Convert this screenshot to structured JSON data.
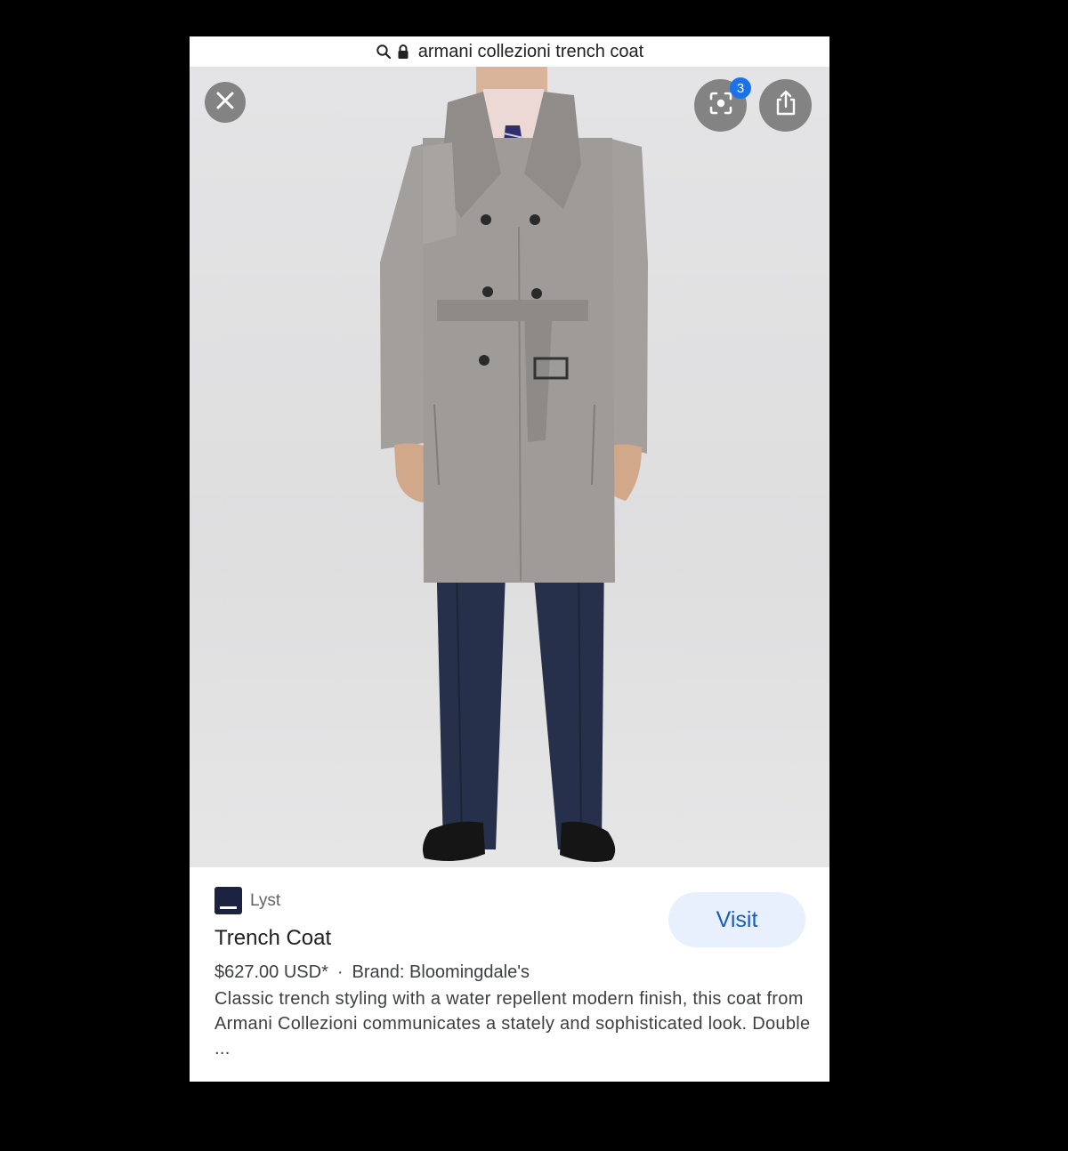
{
  "address_bar": {
    "query": "armani collezioni trench coat",
    "search_icon": "search-icon",
    "lock_icon": "lock-icon"
  },
  "image_viewer": {
    "close_icon": "close-icon",
    "lens_icon": "lens-icon",
    "lens_badge_count": "3",
    "share_icon": "share-icon"
  },
  "result": {
    "source_name": "Lyst",
    "title": "Trench Coat",
    "visit_label": "Visit",
    "price": "$627.00 USD*",
    "separator": "·",
    "brand": "Brand: Bloomingdale's",
    "description": "Classic trench styling with a water repellent modern finish, this coat from Armani Collezioni communicates a stately and sophisticated look. Double ..."
  },
  "colors": {
    "visit_button_bg": "#e8f0fe",
    "visit_button_text": "#1a5cb8",
    "badge": "#1a73e8",
    "coat": "#9e9b98",
    "trousers": "#27304a"
  }
}
